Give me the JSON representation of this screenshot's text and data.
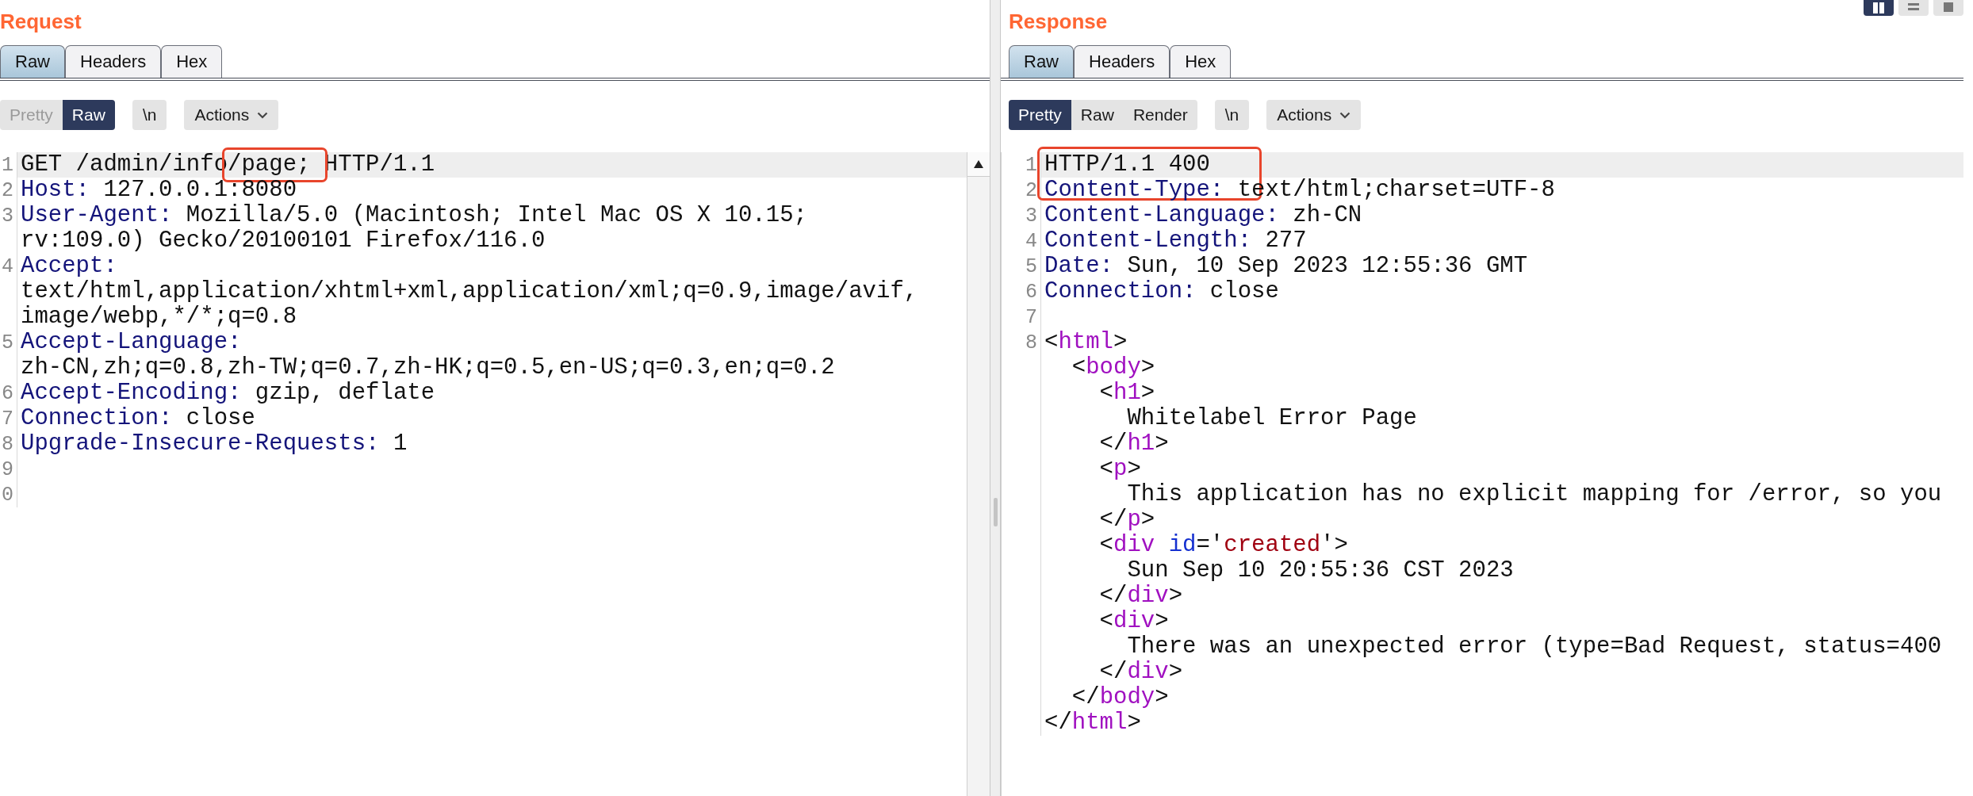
{
  "panes": [
    {
      "title": "Request",
      "tabs": [
        {
          "label": "Raw",
          "selected": true
        },
        {
          "label": "Headers",
          "selected": false
        },
        {
          "label": "Hex",
          "selected": false
        }
      ],
      "view_modes": [
        {
          "label": "Pretty",
          "selected": false,
          "disabled": true
        },
        {
          "label": "Raw",
          "selected": true,
          "disabled": false
        }
      ],
      "newline_button": "\\n",
      "actions_button": "Actions",
      "annotation": {
        "kind": "box"
      },
      "scrollbar": true,
      "lines": [
        {
          "number": "1",
          "current": true,
          "parts": [
            {
              "kind": "plain",
              "text": "GET /admin/info/page; HTTP/1.1"
            }
          ]
        },
        {
          "number": "2",
          "current": false,
          "parts": [
            {
              "kind": "key",
              "text": "Host:"
            },
            {
              "kind": "plain",
              "text": " 127.0.0.1:8080"
            }
          ]
        },
        {
          "number": "3",
          "current": false,
          "parts": [
            {
              "kind": "key",
              "text": "User-Agent:"
            },
            {
              "kind": "plain",
              "text": " Mozilla/5.0 (Macintosh; Intel Mac OS X 10.15;"
            }
          ]
        },
        {
          "current": false,
          "parts": [
            {
              "kind": "plain",
              "text": "rv:109.0) Gecko/20100101 Firefox/116.0"
            }
          ]
        },
        {
          "number": "4",
          "current": false,
          "parts": [
            {
              "kind": "key",
              "text": "Accept:"
            }
          ]
        },
        {
          "current": false,
          "parts": [
            {
              "kind": "plain",
              "text": "text/html,application/xhtml+xml,application/xml;q=0.9,image/avif,"
            }
          ]
        },
        {
          "current": false,
          "parts": [
            {
              "kind": "plain",
              "text": "image/webp,*/*;q=0.8"
            }
          ]
        },
        {
          "number": "5",
          "current": false,
          "parts": [
            {
              "kind": "key",
              "text": "Accept-Language:"
            }
          ]
        },
        {
          "current": false,
          "parts": [
            {
              "kind": "plain",
              "text": "zh-CN,zh;q=0.8,zh-TW;q=0.7,zh-HK;q=0.5,en-US;q=0.3,en;q=0.2"
            }
          ]
        },
        {
          "number": "6",
          "current": false,
          "parts": [
            {
              "kind": "key",
              "text": "Accept-Encoding:"
            },
            {
              "kind": "plain",
              "text": " gzip, deflate"
            }
          ]
        },
        {
          "number": "7",
          "current": false,
          "parts": [
            {
              "kind": "key",
              "text": "Connection:"
            },
            {
              "kind": "plain",
              "text": " close"
            }
          ]
        },
        {
          "number": "8",
          "current": false,
          "parts": [
            {
              "kind": "key",
              "text": "Upgrade-Insecure-Requests:"
            },
            {
              "kind": "plain",
              "text": " 1"
            }
          ]
        },
        {
          "number": "9",
          "current": false
        },
        {
          "number": "0",
          "current": false
        }
      ]
    },
    {
      "title": "Response",
      "tabs": [
        {
          "label": "Raw",
          "selected": true
        },
        {
          "label": "Headers",
          "selected": false
        },
        {
          "label": "Hex",
          "selected": false
        }
      ],
      "view_modes": [
        {
          "label": "Pretty",
          "selected": true,
          "disabled": false
        },
        {
          "label": "Raw",
          "selected": false,
          "disabled": false
        },
        {
          "label": "Render",
          "selected": false,
          "disabled": false
        }
      ],
      "newline_button": "\\n",
      "actions_button": "Actions",
      "annotation": {
        "kind": "box"
      },
      "scrollbar": false,
      "lines": [
        {
          "number": "1",
          "current": true,
          "parts": [
            {
              "kind": "plain",
              "text": "HTTP/1.1 400"
            }
          ]
        },
        {
          "number": "2",
          "current": false,
          "parts": [
            {
              "kind": "key",
              "text": "Content-Type:"
            },
            {
              "kind": "plain",
              "text": " text/html;charset=UTF-8"
            }
          ]
        },
        {
          "number": "3",
          "current": false,
          "parts": [
            {
              "kind": "key",
              "text": "Content-Language:"
            },
            {
              "kind": "plain",
              "text": " zh-CN"
            }
          ]
        },
        {
          "number": "4",
          "current": false,
          "parts": [
            {
              "kind": "key",
              "text": "Content-Length:"
            },
            {
              "kind": "plain",
              "text": " 277"
            }
          ]
        },
        {
          "number": "5",
          "current": false,
          "parts": [
            {
              "kind": "key",
              "text": "Date:"
            },
            {
              "kind": "plain",
              "text": " Sun, 10 Sep 2023 12:55:36 GMT"
            }
          ]
        },
        {
          "number": "6",
          "current": false,
          "parts": [
            {
              "kind": "key",
              "text": "Connection:"
            },
            {
              "kind": "plain",
              "text": " close"
            }
          ]
        },
        {
          "number": "7",
          "current": false
        },
        {
          "number": "8",
          "current": false,
          "parts": [
            {
              "kind": "plain",
              "text": "<"
            },
            {
              "kind": "tag",
              "text": "html"
            },
            {
              "kind": "plain",
              "text": ">"
            }
          ]
        },
        {
          "current": false,
          "parts": [
            {
              "kind": "plain",
              "text": "  <"
            },
            {
              "kind": "tag",
              "text": "body"
            },
            {
              "kind": "plain",
              "text": ">"
            }
          ]
        },
        {
          "current": false,
          "parts": [
            {
              "kind": "plain",
              "text": "    <"
            },
            {
              "kind": "tag",
              "text": "h1"
            },
            {
              "kind": "plain",
              "text": ">"
            }
          ]
        },
        {
          "current": false,
          "parts": [
            {
              "kind": "plain",
              "text": "      Whitelabel Error Page"
            }
          ]
        },
        {
          "current": false,
          "parts": [
            {
              "kind": "plain",
              "text": "    </"
            },
            {
              "kind": "tag",
              "text": "h1"
            },
            {
              "kind": "plain",
              "text": ">"
            }
          ]
        },
        {
          "current": false,
          "parts": [
            {
              "kind": "plain",
              "text": "    <"
            },
            {
              "kind": "tag",
              "text": "p"
            },
            {
              "kind": "plain",
              "text": ">"
            }
          ]
        },
        {
          "current": false,
          "parts": [
            {
              "kind": "plain",
              "text": "      This application has no explicit mapping for /error, so you"
            }
          ]
        },
        {
          "current": false,
          "parts": [
            {
              "kind": "plain",
              "text": "    </"
            },
            {
              "kind": "tag",
              "text": "p"
            },
            {
              "kind": "plain",
              "text": ">"
            }
          ]
        },
        {
          "current": false,
          "parts": [
            {
              "kind": "plain",
              "text": "    <"
            },
            {
              "kind": "tag",
              "text": "div"
            },
            {
              "kind": "attr",
              "text": " id"
            },
            {
              "kind": "plain",
              "text": "='"
            },
            {
              "kind": "string",
              "text": "created"
            },
            {
              "kind": "plain",
              "text": "'>"
            }
          ]
        },
        {
          "current": false,
          "parts": [
            {
              "kind": "plain",
              "text": "      Sun Sep 10 20:55:36 CST 2023"
            }
          ]
        },
        {
          "current": false,
          "parts": [
            {
              "kind": "plain",
              "text": "    </"
            },
            {
              "kind": "tag",
              "text": "div"
            },
            {
              "kind": "plain",
              "text": ">"
            }
          ]
        },
        {
          "current": false,
          "parts": [
            {
              "kind": "plain",
              "text": "    <"
            },
            {
              "kind": "tag",
              "text": "div"
            },
            {
              "kind": "plain",
              "text": ">"
            }
          ]
        },
        {
          "current": false,
          "parts": [
            {
              "kind": "plain",
              "text": "      There was an unexpected error (type=Bad Request, status=400"
            }
          ]
        },
        {
          "current": false,
          "parts": [
            {
              "kind": "plain",
              "text": "    </"
            },
            {
              "kind": "tag",
              "text": "div"
            },
            {
              "kind": "plain",
              "text": ">"
            }
          ]
        },
        {
          "current": false,
          "parts": [
            {
              "kind": "plain",
              "text": "  </"
            },
            {
              "kind": "tag",
              "text": "body"
            },
            {
              "kind": "plain",
              "text": ">"
            }
          ]
        },
        {
          "current": false,
          "parts": [
            {
              "kind": "plain",
              "text": "</"
            },
            {
              "kind": "tag",
              "text": "html"
            },
            {
              "kind": "plain",
              "text": ">"
            }
          ]
        }
      ]
    }
  ],
  "layout_buttons": [
    {
      "kind": "columns",
      "selected": true
    },
    {
      "kind": "rows",
      "selected": false
    },
    {
      "kind": "single",
      "selected": false
    }
  ]
}
